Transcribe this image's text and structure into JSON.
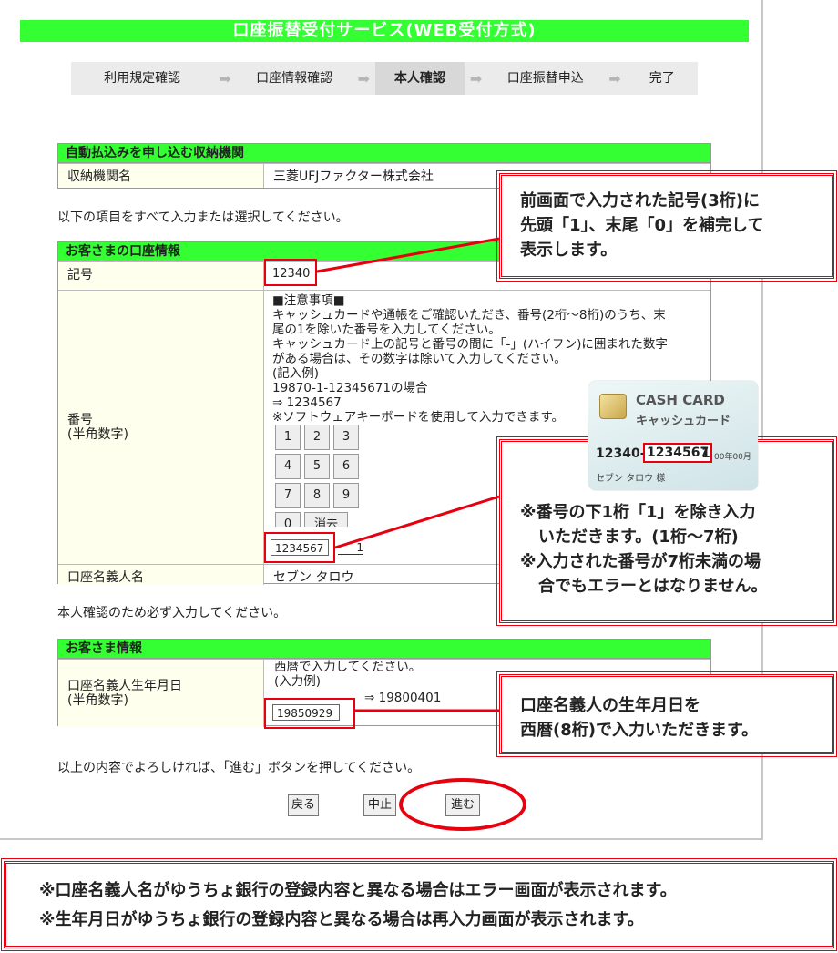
{
  "title": "口座振替受付サービス(WEB受付方式)",
  "steps": [
    "利用規定確認",
    "口座情報確認",
    "本人確認",
    "口座振替申込",
    "完了"
  ],
  "active_step": 2,
  "institution": {
    "header": "自動払込みを申し込む収納機関",
    "label": "収納機関名",
    "value": "三菱UFJファクター株式会社"
  },
  "instruction1": "以下の項目をすべて入力または選択してください。",
  "account": {
    "header": "お客さまの口座情報",
    "symbol_label": "記号",
    "symbol_value": "12340",
    "number_label": "番号\n(半角数字)",
    "note_lines": [
      "■注意事項■",
      "キャッシュカードや通帳をご確認いただき、番号(2桁〜8桁)のうち、末",
      "尾の1を除いた番号を入力してください。",
      "キャッシュカード上の記号と番号の間に「-」(ハイフン)に囲まれた数字",
      "がある場合は、その数字は除いて入力してください。",
      "(記入例)",
      "19870-1-12345671の場合",
      "⇒ 1234567",
      "※ソフトウェアキーボードを使用して入力できます。"
    ],
    "keypad": [
      "1",
      "2",
      "3",
      "4",
      "5",
      "6",
      "7",
      "8",
      "9",
      "0",
      "消去"
    ],
    "number_value": "1234567",
    "number_suffix": "1",
    "holder_label": "口座名義人名",
    "holder_value": "セブン タロウ"
  },
  "instruction2": "本人確認のため必ず入力してください。",
  "customer": {
    "header": "お客さま情報",
    "dob_label": "口座名義人生年月日\n(半角数字)",
    "dob_note1": "西暦で入力してください。",
    "dob_note2": "(入力例)",
    "dob_example": "⇒ 19800401",
    "dob_value": "19850929"
  },
  "instruction3": "以上の内容でよろしければ、「進む」ボタンを押してください。",
  "buttons": {
    "back": "戻る",
    "cancel": "中止",
    "next": "進む"
  },
  "callouts": {
    "symbol": [
      "前画面で入力された記号(3桁)に",
      "先頭「1」、末尾「0」を補完して",
      "表示します。"
    ],
    "number": [
      "※番号の下1桁「1」を除き入力",
      "いただきます。(1桁〜7桁)",
      "※入力された番号が7桁未満の場",
      "合でもエラーとはなりません。"
    ],
    "dob": [
      "口座名義人の生年月日を",
      "西暦(8桁)で入力いただきます。"
    ]
  },
  "card": {
    "title": "CASH CARD",
    "subtitle": "キャッシュカード",
    "symbol": "12340-",
    "number": "1234567",
    "suffix": "1",
    "date": "00年00月",
    "holder": "セブン タロウ 様"
  },
  "bottom_note": [
    "※口座名義人名がゆうちょ銀行の登録内容と異なる場合はエラー画面が表示されます。",
    "※生年月日がゆうちょ銀行の登録内容と異なる場合は再入力画面が表示されます。"
  ],
  "colors": {
    "green": "#33ff33",
    "red": "#e8000f",
    "label_bg": "#ffffee"
  }
}
